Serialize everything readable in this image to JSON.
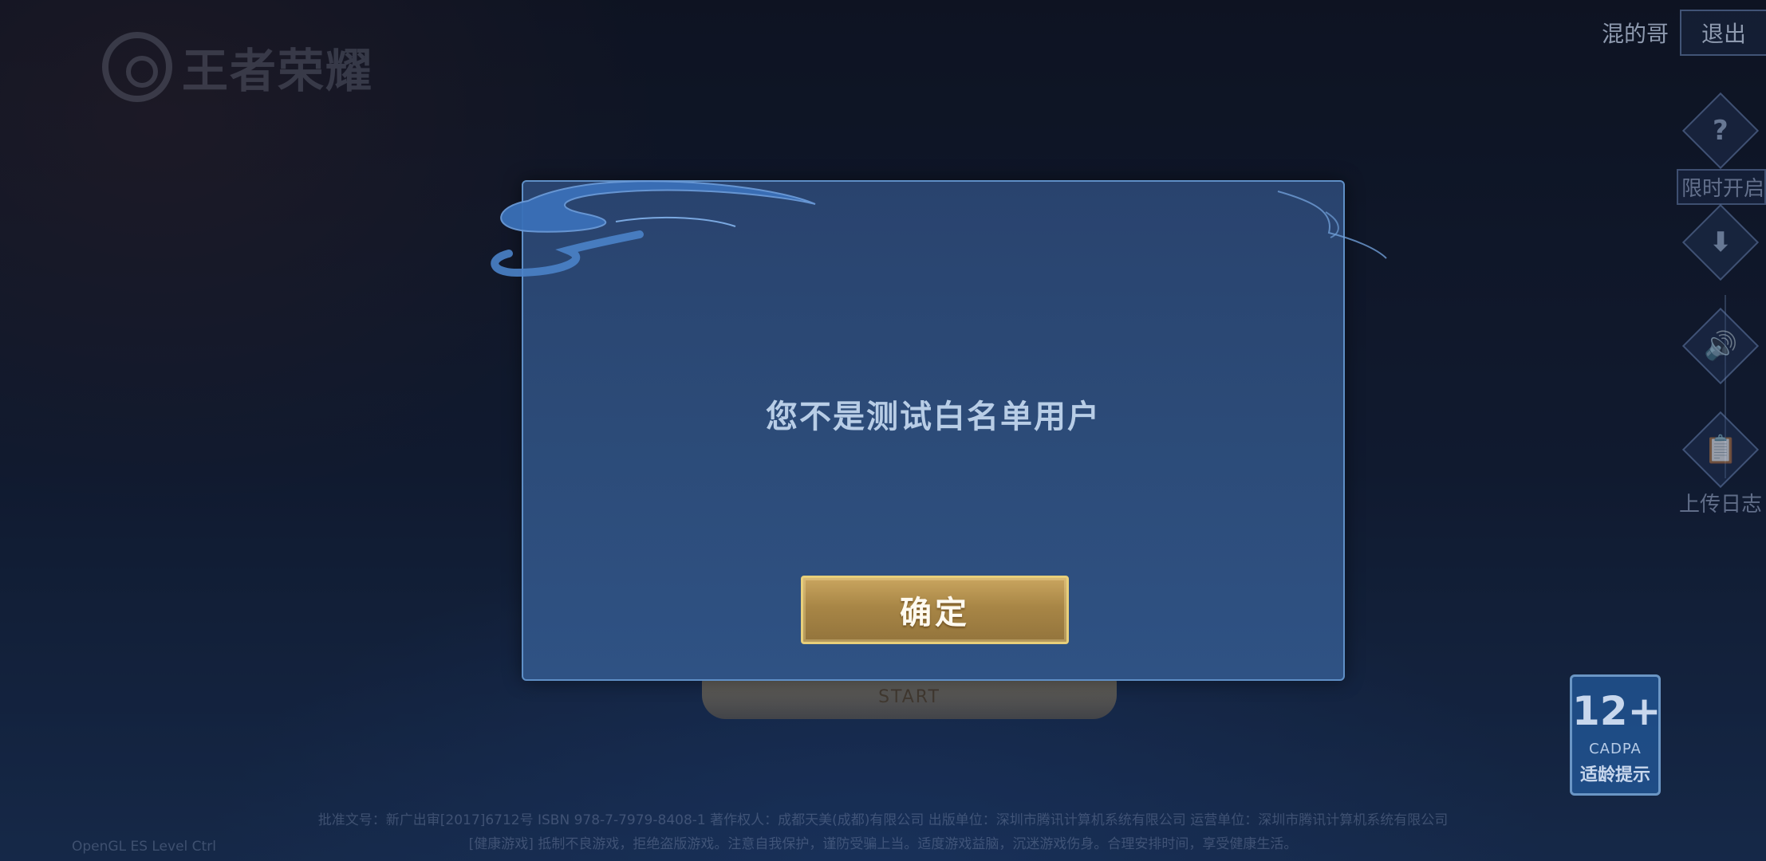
{
  "background": {
    "logo_text": "王者荣耀",
    "user": {
      "name": "混的哥",
      "logout_label": "退出"
    },
    "side_menu": [
      {
        "icon": "question-icon",
        "glyph": "?",
        "label": "限时开启"
      },
      {
        "icon": "download-icon",
        "glyph": "⬇",
        "label": ""
      },
      {
        "icon": "speaker-icon",
        "glyph": "🔊",
        "label": ""
      },
      {
        "icon": "log-icon",
        "glyph": "📋",
        "label": "上传日志"
      }
    ],
    "start_label": "START",
    "age_badge": {
      "age": "12+",
      "org": "CADPA",
      "hint": "适龄提示"
    },
    "footer_lines": [
      "批准文号：新广出审[2017]6712号 ISBN 978-7-7979-8408-1 著作权人：成都天美(成都)有限公司 出版单位：深圳市腾讯计算机系统有限公司 运营单位：深圳市腾讯计算机系统有限公司",
      "[健康游戏] 抵制不良游戏，拒绝盗版游戏。注意自我保护，谨防受骗上当。适度游戏益脑，沉迷游戏伤身。合理安排时间，享受健康生活。"
    ],
    "opengl_label": "OpenGL ES Level Ctrl"
  },
  "dialog": {
    "message": "您不是测试白名单用户",
    "confirm_label": "确定"
  },
  "colors": {
    "dialog_border": "#5f8fc6",
    "dialog_bg": "#2c4b78",
    "message_text": "#b8cde6",
    "button_gold": "#b08e4e",
    "button_border": "#e8cf7a"
  }
}
